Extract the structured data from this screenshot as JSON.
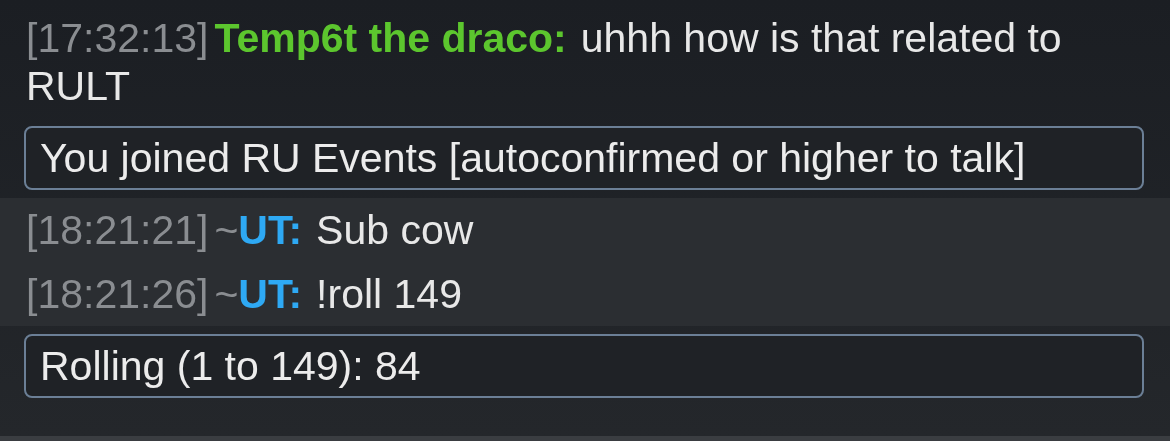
{
  "messages": [
    {
      "kind": "chat",
      "time": "[17:32:13]",
      "user": "Temp6t the draco:",
      "color": "#5cc62e",
      "text": "uhhh how is that related to RULT"
    },
    {
      "kind": "notice",
      "text": "You joined RU Events [autoconfirmed or higher to talk]"
    },
    {
      "kind": "band",
      "messages": [
        {
          "kind": "chat",
          "time": "[18:21:21]",
          "rank": "~",
          "user": "UT:",
          "color": "#2ea9f4",
          "text": "Sub cow"
        },
        {
          "kind": "chat",
          "time": "[18:21:26]",
          "rank": "~",
          "user": "UT:",
          "color": "#2ea9f4",
          "text": "!roll 149"
        }
      ]
    },
    {
      "kind": "notice",
      "text": "Rolling (1 to 149): 84"
    }
  ]
}
